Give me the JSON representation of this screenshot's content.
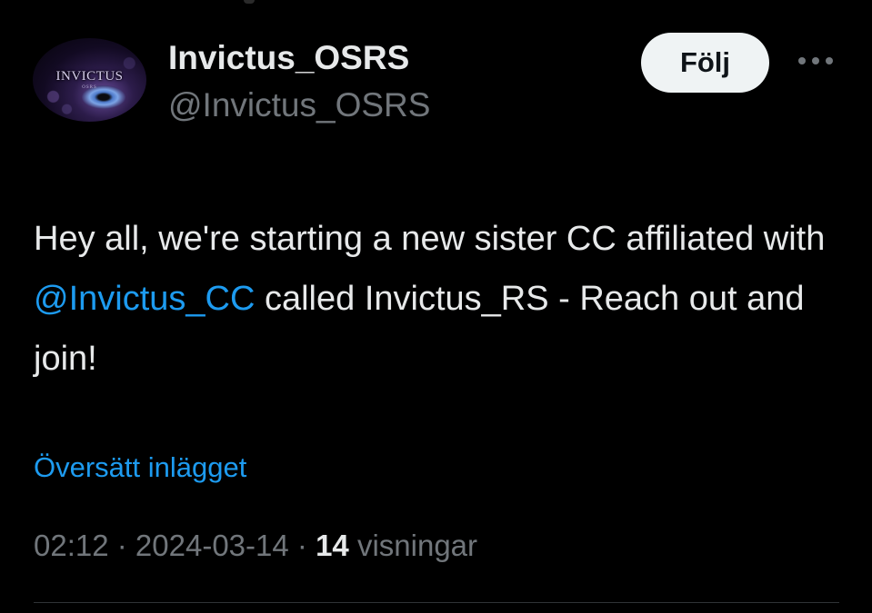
{
  "author": {
    "display_name": "Invictus_OSRS",
    "handle": "@Invictus_OSRS",
    "avatar_icon": "invictus-dragon-eye-avatar",
    "avatar_text": "INVICTUS",
    "avatar_subtext": "OSRS"
  },
  "follow_button": {
    "label": "Följ"
  },
  "more_icon": "more-horizontal-icon",
  "tweet": {
    "text_before_mention": "Hey all, we're starting a new sister CC affiliated with ",
    "mention": "@Invictus_CC",
    "text_after_mention": " called Invictus_RS - Reach out and join!"
  },
  "translate_link": "Översätt inlägget",
  "meta": {
    "time": "02:12",
    "separator": " · ",
    "date": "2024-03-14",
    "views_count": "14",
    "views_label": " visningar"
  },
  "colors": {
    "background": "#000000",
    "primary_text": "#e7e9ea",
    "secondary_text": "#71767b",
    "link": "#1d9bf0",
    "button_bg": "#eff3f4",
    "divider": "#2f3336"
  }
}
